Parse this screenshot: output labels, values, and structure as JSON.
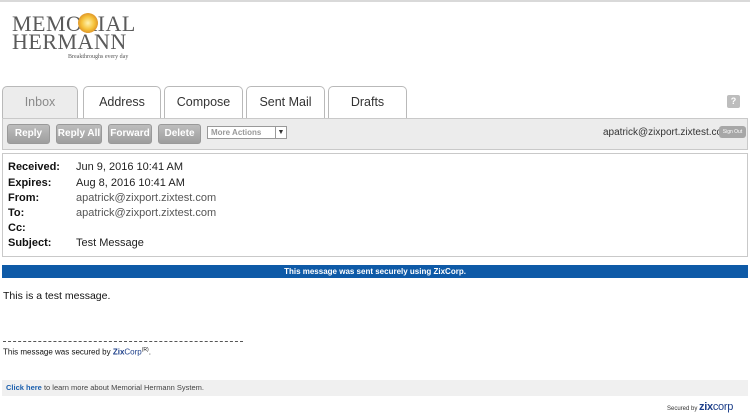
{
  "brand": {
    "line1": "MEMORIAL",
    "line2": "HERMANN",
    "tagline": "Breakthroughs every day"
  },
  "tabs": [
    {
      "label": "Inbox",
      "active": true
    },
    {
      "label": "Address",
      "active": false
    },
    {
      "label": "Compose",
      "active": false
    },
    {
      "label": "Sent Mail",
      "active": false
    },
    {
      "label": "Drafts",
      "active": false
    }
  ],
  "help_icon_label": "?",
  "toolbar": {
    "reply": "Reply",
    "reply_all": "Reply All",
    "forward": "Forward",
    "delete": "Delete",
    "more_actions": "More Actions",
    "user_email": "apatrick@zixport.zixtest.com",
    "sign_out": "Sign Out"
  },
  "message": {
    "received_label": "Received:",
    "received": "Jun 9, 2016 10:41 AM",
    "expires_label": "Expires:",
    "expires": "Aug 8, 2016 10:41 AM",
    "from_label": "From:",
    "from": "apatrick@zixport.zixtest.com",
    "to_label": "To:",
    "to": "apatrick@zixport.zixtest.com",
    "cc_label": "Cc:",
    "cc": "",
    "subject_label": "Subject:",
    "subject": "Test Message",
    "body": "This is a test message."
  },
  "banner": "This message was sent securely using ZixCorp.",
  "secured_line": {
    "prefix": "This message was secured by ",
    "zix": "Zix",
    "corp": "Corp",
    "reg": "(R)",
    "suffix": "."
  },
  "footer": {
    "link": "Click here",
    "text": " to learn more about Memorial Hermann System."
  },
  "secured_by": {
    "prefix": "Secured by",
    "zix": "zix",
    "corp": "corp"
  },
  "colors": {
    "banner": "#0e5aa7",
    "link": "#1b5fad"
  }
}
